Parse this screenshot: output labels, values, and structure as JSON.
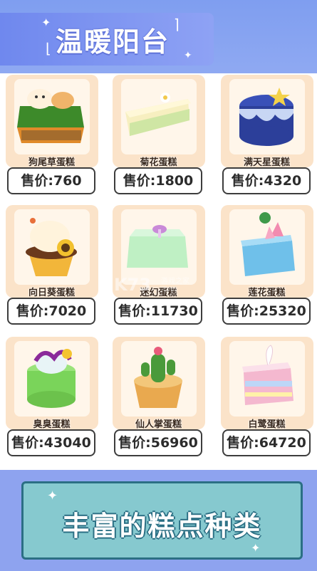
{
  "header": {
    "title": "温暖阳台"
  },
  "cakes": [
    {
      "name": "狗尾草蛋糕",
      "price": "售价:760",
      "icon": "grass-cake-icon",
      "color": "#5fae3a"
    },
    {
      "name": "菊花蛋糕",
      "price": "售价:1800",
      "icon": "chrysanthemum-cake-icon",
      "color": "#f3e7a8"
    },
    {
      "name": "满天星蛋糕",
      "price": "售价:4320",
      "icon": "starry-cake-icon",
      "color": "#2c3f9a"
    },
    {
      "name": "向日葵蛋糕",
      "price": "售价:7020",
      "icon": "sunflower-cake-icon",
      "color": "#f2b63a"
    },
    {
      "name": "迷幻蛋糕",
      "price": "售价:11730",
      "icon": "psychedelic-cake-icon",
      "color": "#bff0c4"
    },
    {
      "name": "莲花蛋糕",
      "price": "售价:25320",
      "icon": "lotus-cake-icon",
      "color": "#6fc0ea"
    },
    {
      "name": "臭臭蛋糕",
      "price": "售价:43040",
      "icon": "stinky-cake-icon",
      "color": "#7ad45a"
    },
    {
      "name": "仙人掌蛋糕",
      "price": "售价:56960",
      "icon": "cactus-cake-icon",
      "color": "#e9a94f"
    },
    {
      "name": "白鹭蛋糕",
      "price": "售价:64720",
      "icon": "egret-cake-icon",
      "color": "#f4b8cf"
    }
  ],
  "footer": {
    "slogan": "丰富的糕点种类"
  },
  "watermark": {
    "logo": "K73",
    "site": "游戏之家",
    "url": ".com"
  }
}
